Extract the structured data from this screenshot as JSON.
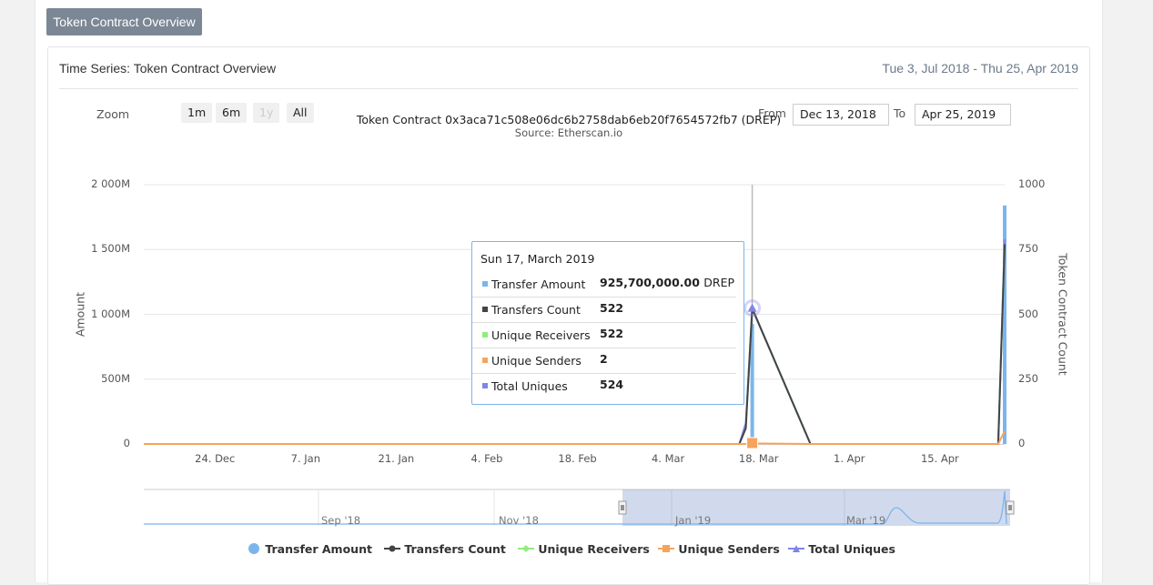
{
  "panel_button": "Token Contract Overview",
  "card": {
    "title": "Time Series: Token Contract Overview",
    "date_range": "Tue 3, Jul 2018 - Thu 25, Apr 2019"
  },
  "chart": {
    "title": "Token Contract 0x3aca71c508e06dc6b2758dab6eb20f7654572fb7 (DREP)",
    "subtitle": "Source: Etherscan.io",
    "zoom_label": "Zoom",
    "zoom_buttons": [
      "1m",
      "6m",
      "1y",
      "All"
    ],
    "from_label": "From",
    "to_label": "To",
    "from_value": "Dec 13, 2018",
    "to_value": "Apr 25, 2019"
  },
  "chart_data": {
    "type": "line",
    "xlabel": "",
    "ylabel": "Amount",
    "y2label": "Token Contract Count",
    "x_ticks": [
      "24. Dec",
      "7. Jan",
      "21. Jan",
      "4. Feb",
      "18. Feb",
      "4. Mar",
      "18. Mar",
      "1. Apr",
      "15. Apr"
    ],
    "y_ticks": [
      "0",
      "500M",
      "1 000M",
      "1 500M",
      "2 000M"
    ],
    "y2_ticks": [
      "0",
      "250",
      "500",
      "750",
      "1000"
    ],
    "ylim": [
      0,
      2000000000
    ],
    "y2lim": [
      0,
      1000
    ],
    "x": [
      "2018-12-13",
      "2019-03-15",
      "2019-03-16",
      "2019-03-17",
      "2019-03-26",
      "2019-04-24",
      "2019-04-25"
    ],
    "series": [
      {
        "name": "Transfer Amount",
        "axis": "left",
        "type": "column",
        "color": "#7cb5ec",
        "points": [
          [
            "2019-03-17",
            925700000
          ],
          [
            "2019-04-25",
            1840000000
          ]
        ]
      },
      {
        "name": "Transfers Count",
        "axis": "right",
        "color": "#434348",
        "values": [
          0,
          0,
          60,
          522,
          0,
          0,
          770
        ]
      },
      {
        "name": "Unique Receivers",
        "axis": "right",
        "color": "#90ed7d",
        "values": [
          0,
          0,
          60,
          522,
          0,
          0,
          770
        ]
      },
      {
        "name": "Unique Senders",
        "axis": "right",
        "color": "#f7a35c",
        "values": [
          0,
          0,
          0,
          2,
          0,
          0,
          50
        ]
      },
      {
        "name": "Total Uniques",
        "axis": "right",
        "color": "#8085e9",
        "values": [
          0,
          0,
          80,
          524,
          0,
          0,
          790
        ]
      }
    ],
    "legend": [
      "Transfer Amount",
      "Transfers Count",
      "Unique Receivers",
      "Unique Senders",
      "Total Uniques"
    ],
    "legend_position": "bottom",
    "grid": true,
    "navigator_ticks": [
      "Sep '18",
      "Nov '18",
      "Jan '19",
      "Mar '19"
    ]
  },
  "tooltip": {
    "date": "Sun 17, March 2019",
    "rows": [
      {
        "name": "Transfer Amount",
        "value": "925,700,000.00",
        "unit": "DREP",
        "color": "#7cb5ec"
      },
      {
        "name": "Transfers Count",
        "value": "522",
        "unit": "",
        "color": "#434348"
      },
      {
        "name": "Unique Receivers",
        "value": "522",
        "unit": "",
        "color": "#90ed7d"
      },
      {
        "name": "Unique Senders",
        "value": "2",
        "unit": "",
        "color": "#f7a35c"
      },
      {
        "name": "Total Uniques",
        "value": "524",
        "unit": "",
        "color": "#8085e9"
      }
    ]
  }
}
